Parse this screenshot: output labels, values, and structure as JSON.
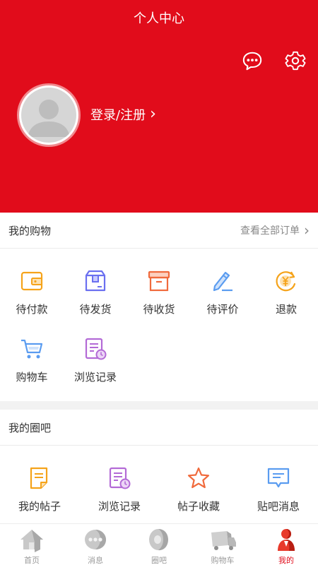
{
  "header": {
    "title": "个人中心",
    "login_label": "登录/注册",
    "login_arrow": "›",
    "bg_color": "#e10c1b"
  },
  "shopping": {
    "title": "我的购物",
    "view_all": "查看全部订单",
    "view_all_arrow": "›",
    "items": [
      {
        "label": "待付款",
        "icon": "wallet-icon",
        "color": "#f5a31a"
      },
      {
        "label": "待发货",
        "icon": "package-icon",
        "color": "#6a6ff0"
      },
      {
        "label": "待收货",
        "icon": "box-icon",
        "color": "#f06a3c"
      },
      {
        "label": "待评价",
        "icon": "pencil-icon",
        "color": "#5a9cf0"
      },
      {
        "label": "退款",
        "icon": "refund-yen-icon",
        "color": "#f5a31a"
      },
      {
        "label": "购物车",
        "icon": "cart-icon",
        "color": "#5a9cf0"
      },
      {
        "label": "浏览记录",
        "icon": "history-icon",
        "color": "#b36ad6"
      }
    ]
  },
  "circle": {
    "title": "我的圈吧",
    "items": [
      {
        "label": "我的帖子",
        "icon": "document-icon",
        "color": "#f5a31a"
      },
      {
        "label": "浏览记录",
        "icon": "history-icon",
        "color": "#b36ad6"
      },
      {
        "label": "帖子收藏",
        "icon": "star-icon",
        "color": "#f06a3c"
      },
      {
        "label": "贴吧消息",
        "icon": "message-icon",
        "color": "#5a9cf0"
      }
    ]
  },
  "tabbar": {
    "active_color": "#e10c1b",
    "items": [
      {
        "label": "首页",
        "icon": "home-icon"
      },
      {
        "label": "消息",
        "icon": "chat-icon"
      },
      {
        "label": "圈吧",
        "icon": "circle-icon"
      },
      {
        "label": "购物车",
        "icon": "truck-icon"
      },
      {
        "label": "我的",
        "icon": "user-icon",
        "active": true
      }
    ]
  }
}
